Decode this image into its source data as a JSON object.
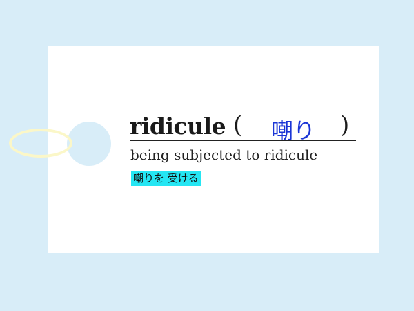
{
  "card": {
    "word": "ridicule",
    "paren_open": "(",
    "kanji": "嘲り",
    "paren_close": ")",
    "meaning": "being subjected to ridicule",
    "japanese_phrase": "嘲りを 受ける"
  },
  "colors": {
    "background": "#d8edf8",
    "card": "#ffffff",
    "kanji": "#1a35d6",
    "badge": "#25e6f3",
    "string": "#fbf7c8"
  }
}
